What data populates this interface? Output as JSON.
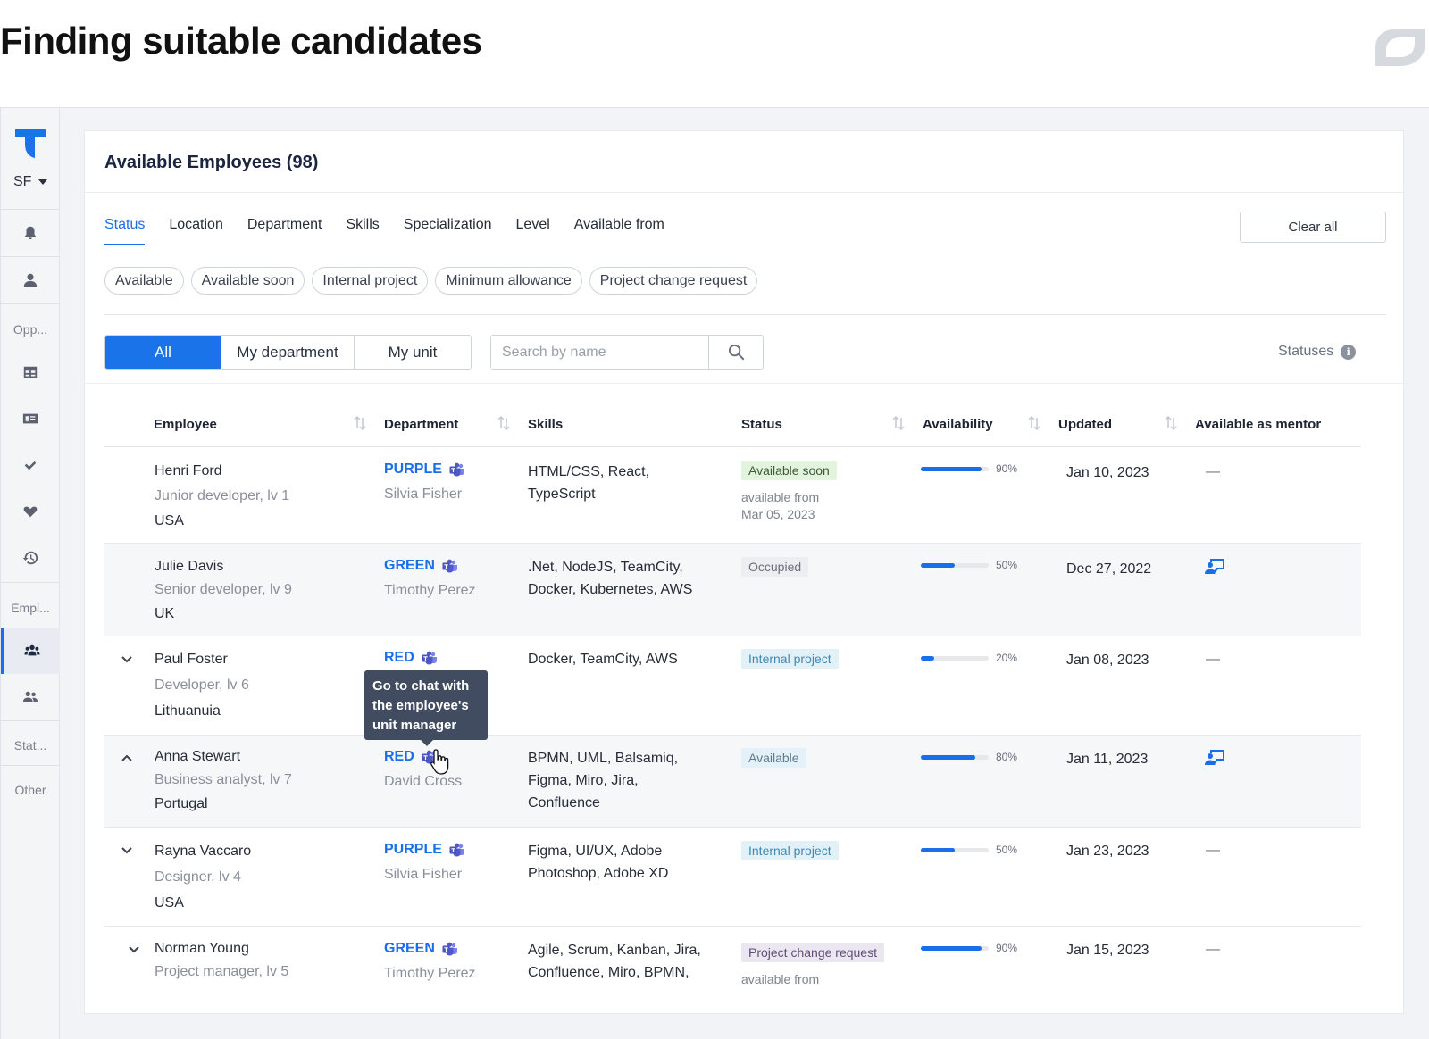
{
  "heading": "Finding suitable candidates",
  "rail": {
    "org": "SF",
    "labels": {
      "opportunities": "Opp...",
      "employees": "Empl...",
      "statistics": "Stat...",
      "other": "Other"
    }
  },
  "card": {
    "title": "Available Employees (98)"
  },
  "filter_tabs": [
    {
      "label": "Status"
    },
    {
      "label": "Location"
    },
    {
      "label": "Department"
    },
    {
      "label": "Skills"
    },
    {
      "label": "Specialization"
    },
    {
      "label": "Level"
    },
    {
      "label": "Available from"
    }
  ],
  "clear_label": "Clear all",
  "chips": [
    {
      "label": "Available"
    },
    {
      "label": "Available soon"
    },
    {
      "label": "Internal project"
    },
    {
      "label": "Minimum allowance"
    },
    {
      "label": "Project change request"
    }
  ],
  "scope": {
    "all": "All",
    "dept": "My department",
    "unit": "My unit"
  },
  "search": {
    "placeholder": "Search by name"
  },
  "statuses_label": "Statuses",
  "columns": {
    "employee": "Employee",
    "department": "Department",
    "skills": "Skills",
    "status": "Status",
    "availability": "Availability",
    "updated": "Updated",
    "mentor": "Available as mentor"
  },
  "rows": [
    {
      "name": "Henri Ford",
      "role": "Junior developer, lv 1",
      "country": "USA",
      "dept": "PURPLE",
      "manager": "Silvia Fisher",
      "skills1": "HTML/CSS, React,",
      "skills2": "TypeScript",
      "skills3": "",
      "status": "Available soon",
      "from1": "available from",
      "from2": "Mar 05, 2023",
      "availability": 90,
      "pct": "90%",
      "updated": "Jan 10, 2023",
      "mentor": "—"
    },
    {
      "name": "Julie Davis",
      "role": "Senior developer, lv 9",
      "country": "UK",
      "dept": "GREEN",
      "manager": "Timothy Perez",
      "skills1": ".Net, NodeJS, TeamCity,",
      "skills2": "Docker, Kubernetes, AWS",
      "skills3": "",
      "status": "Occupied",
      "availability": 50,
      "pct": "50%",
      "updated": "Dec 27, 2022",
      "mentor": ""
    },
    {
      "name": "Paul Foster",
      "role": "Developer, lv 6",
      "country": "Lithuanuia",
      "dept": "RED",
      "manager": "",
      "skills1": "Docker, TeamCity, AWS",
      "skills2": "",
      "skills3": "",
      "status": "Internal project",
      "availability": 20,
      "pct": "20%",
      "updated": "Jan 08, 2023",
      "mentor": "—"
    },
    {
      "name": "Anna Stewart",
      "role": "Business analyst, lv 7",
      "country": "Portugal",
      "dept": "RED",
      "manager": "David Cross",
      "skills1": "BPMN, UML, Balsamiq,",
      "skills2": "Figma, Miro, Jira,",
      "skills3": "Confluence",
      "status": "Available",
      "availability": 80,
      "pct": "80%",
      "updated": "Jan 11, 2023",
      "mentor": ""
    },
    {
      "name": "Rayna Vaccaro",
      "role": "Designer, lv 4",
      "country": "USA",
      "dept": "PURPLE",
      "manager": "Silvia Fisher",
      "skills1": "Figma, UI/UX, Adobe",
      "skills2": "Photoshop, Adobe XD",
      "skills3": "",
      "status": "Internal project",
      "availability": 50,
      "pct": "50%",
      "updated": "Jan 23, 2023",
      "mentor": "—"
    },
    {
      "name": "Norman Young",
      "role": "Project manager, lv 5",
      "country": "",
      "dept": "GREEN",
      "manager": "Timothy Perez",
      "skills1": "Agile, Scrum, Kanban, Jira,",
      "skills2": "Confluence, Miro, BPMN,",
      "skills3": "",
      "status": "Project change request",
      "from1": "available from",
      "availability": 90,
      "pct": "90%",
      "updated": "Jan 15, 2023",
      "mentor": "—"
    }
  ],
  "tooltip": {
    "text": "Go to chat with the employee's unit manager"
  },
  "colors": {
    "accent": "#1a6fe8",
    "tooltip_bg": "#424c61"
  }
}
